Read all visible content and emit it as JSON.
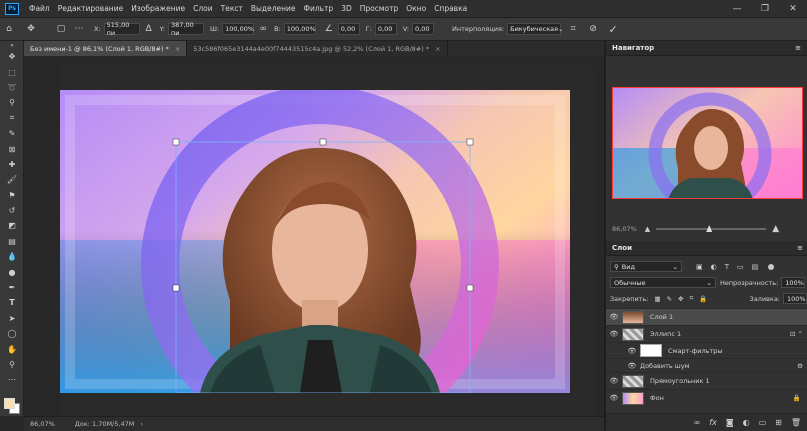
{
  "app": {
    "logo": "Ps",
    "menu": [
      "Файл",
      "Редактирование",
      "Изображение",
      "Слои",
      "Текст",
      "Выделение",
      "Фильтр",
      "3D",
      "Просмотр",
      "Окно",
      "Справка"
    ],
    "window_controls": [
      "—",
      "❐",
      "✕"
    ]
  },
  "options": {
    "x_label": "X:",
    "x_value": "515,00 пи",
    "y_label": "Y:",
    "y_value": "387,00 пи",
    "w_label": "Ш:",
    "w_value": "100,00%",
    "h_label": "В:",
    "h_value": "100,00%",
    "angle_value": "0,00",
    "h_skew_label": "Г:",
    "h_skew_value": "0,00",
    "v_skew_label": "V:",
    "v_skew_value": "0,00",
    "interp_label": "Интерполяция:",
    "interp_value": "Бикубическая"
  },
  "tabs": [
    {
      "label": "Без имени-1 @ 86,1% (Слой 1, RGB/8#) *",
      "close": "×"
    },
    {
      "label": "53c586f065e3144a4e00f74443515c4a.jpg @ 52,2% (Слой 1, RGB/8#) *",
      "close": "×"
    }
  ],
  "status": {
    "zoom": "86,07%",
    "doc": "Док: 1,70M/5,47M",
    "arrow": "›"
  },
  "navigator": {
    "title": "Навигатор",
    "zoom": "86,07%"
  },
  "layers": {
    "title": "Слои",
    "filter_label": "Вид",
    "blend_mode": "Обычные",
    "opacity_label": "Непрозрачность:",
    "opacity_value": "100%",
    "lock_label": "Закрепить:",
    "fill_label": "Заливка:",
    "fill_value": "100%",
    "items": [
      {
        "name": "Слой 1"
      },
      {
        "name": "Эллипс 1"
      },
      {
        "name": "Смарт-фильтры"
      },
      {
        "name": "Добавить шум"
      },
      {
        "name": "Прямоугольник 1"
      },
      {
        "name": "Фон"
      }
    ]
  },
  "colors": {
    "accent": "#31a8ff",
    "bg_dark": "#282828",
    "panel": "#323232",
    "selected_layer": "#4a4a4a",
    "fg_swatch": "#f7e1b5"
  }
}
